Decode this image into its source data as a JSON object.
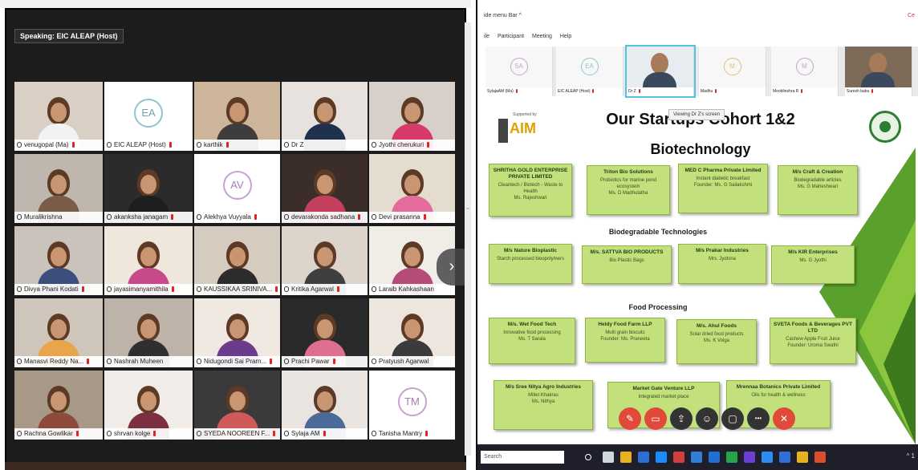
{
  "left_panel": {
    "top_strip_text": "",
    "speaking_label": "Speaking: EIC ALEAP (Host)",
    "next_page_glyph": "›",
    "scroll_glyph": "⌃",
    "participants": [
      {
        "name": "venugopal (Ma)",
        "mic": "muted",
        "kind": "video"
      },
      {
        "name": "EIC ALEAP (Host)",
        "mic": "muted",
        "kind": "initials",
        "initials": "EA",
        "active": true
      },
      {
        "name": "karthik",
        "mic": "muted",
        "kind": "video"
      },
      {
        "name": "Dr Z",
        "mic": "on",
        "kind": "video"
      },
      {
        "name": "Jyothi cherukuri",
        "mic": "muted",
        "kind": "video"
      },
      {
        "name": "Muralikrishna",
        "mic": "on",
        "kind": "video"
      },
      {
        "name": "akanksha janagam",
        "mic": "muted",
        "kind": "video"
      },
      {
        "name": "Alekhya Vuyyala",
        "mic": "muted",
        "kind": "initials",
        "initials": "AV"
      },
      {
        "name": "devarakonda sadhana",
        "mic": "muted",
        "kind": "video"
      },
      {
        "name": "Devi prasanna",
        "mic": "muted",
        "kind": "video"
      },
      {
        "name": "Divya Phani Kodati",
        "mic": "muted",
        "kind": "video"
      },
      {
        "name": "jayasimanyamithila",
        "mic": "muted",
        "kind": "video"
      },
      {
        "name": "KAUSSIKAA SRINIVA...",
        "mic": "muted",
        "kind": "video"
      },
      {
        "name": "Kritika Agarwal",
        "mic": "muted",
        "kind": "video"
      },
      {
        "name": "Laraib Kahkashaan",
        "mic": "on",
        "kind": "video"
      },
      {
        "name": "Manasvi Reddy Na...",
        "mic": "muted",
        "kind": "video"
      },
      {
        "name": "Nashrah Muheen",
        "mic": "on",
        "kind": "video"
      },
      {
        "name": "Nidugondi Sai Prarn...",
        "mic": "muted",
        "kind": "video"
      },
      {
        "name": "Prachi Pawar",
        "mic": "muted",
        "kind": "video"
      },
      {
        "name": "Pratyush Agarwal",
        "mic": "on",
        "kind": "video"
      },
      {
        "name": "Rachna Gowlikar",
        "mic": "muted",
        "kind": "video"
      },
      {
        "name": "shrvan kolge",
        "mic": "muted",
        "kind": "video"
      },
      {
        "name": "SYEDA NOOREEN F...",
        "mic": "muted",
        "kind": "video"
      },
      {
        "name": "Sylaja AM",
        "mic": "muted",
        "kind": "video"
      },
      {
        "name": "Tanisha Mantry",
        "mic": "muted",
        "kind": "initials",
        "initials": "TM"
      }
    ]
  },
  "right_panel": {
    "window_title": "ide menu Bar ^",
    "corner_text": "Ce",
    "menu": [
      "ile",
      "Participant",
      "Meeting",
      "Help"
    ],
    "strip": [
      {
        "name": "SylajaAM (Ma)",
        "initials": "SA",
        "color": "#c8a2cf"
      },
      {
        "name": "EIC ALEAP (Host)",
        "initials": "EA",
        "color": "#8ec6ce"
      },
      {
        "name": "Dr Z",
        "initials": "",
        "color": "#8ec6ce",
        "video": true
      },
      {
        "name": "Madhu",
        "initials": "M",
        "color": "#e0c070"
      },
      {
        "name": "Mooblinshra R",
        "initials": "M",
        "color": "#c8a2cf"
      },
      {
        "name": "Suresh babu",
        "initials": "",
        "color": "#8ec6ce",
        "video": true
      }
    ],
    "slide": {
      "title": "Our Startups Cohort 1&2",
      "subtitle": "Biotechnology",
      "share_note": "Viewing Dr Z's screen",
      "logo_text": "AIM",
      "logo_sup": "Supported by",
      "sections": [
        "Biodegradable Technologies",
        "Food Processing"
      ],
      "cards": [
        {
          "name": "SHRITHA GOLD ENTERPRISE PRIVATE LIMITED",
          "desc": "Cleantech / Biotech - Waste to Health",
          "founder": "Ms. Rajeshwari"
        },
        {
          "name": "Triton Bio Solutions",
          "desc": "Probiotics for marine pond ecosystem",
          "founder": "Ms. D Madhulatha"
        },
        {
          "name": "MED C Pharma Private Limited",
          "desc": "Instant diabetic breakfast",
          "founder": "Founder: Ms. G Sailakshmi"
        },
        {
          "name": "M/s Craft & Creation",
          "desc": "Biodegradable articles",
          "founder": "Ms. G Maheshwari"
        },
        {
          "name": "M/s Nature Bioplastic",
          "desc": "Starch processed bioopolymers",
          "founder": ""
        },
        {
          "name": "M/s. SATTVA BIO PRODUCTS",
          "desc": "Bio Plastic Bags",
          "founder": ""
        },
        {
          "name": "M/s Prakar Industries",
          "desc": "Mrs. Jyotsna",
          "founder": ""
        },
        {
          "name": "M/s KIR Enterprises",
          "desc": "Ms. G Jyothi",
          "founder": ""
        },
        {
          "name": "M/s. Wet Food Tech",
          "desc": "Innovative food processing",
          "founder": "Ms. T Sarala"
        },
        {
          "name": "Heldy Food Farm LLP",
          "desc": "Multi grain biscuits",
          "founder": "Founder: Ms. Praneeta"
        },
        {
          "name": "M/s. Ahul Foods",
          "desc": "Solar dried food products",
          "founder": "Ms. K Volga"
        },
        {
          "name": "SVETA Foods & Beverages PVT LTD",
          "desc": "Cashew Apple Fruit Juice",
          "founder": "Founder: Uroma Swathi"
        },
        {
          "name": "M/s Sree Nitya Agro Industries",
          "desc": "Millet Khakras",
          "founder": "Ms. Nithya"
        },
        {
          "name": "Market Gate Venture LLP",
          "desc": "Integrated market place",
          "founder": ""
        },
        {
          "name": "Mrennaa Botanics Private Limited",
          "desc": "Oils for health & wellness",
          "founder": ""
        }
      ]
    },
    "controls": [
      "mic-off",
      "video-off",
      "share",
      "participants",
      "chat",
      "more",
      "end"
    ],
    "taskbar_search": "Search",
    "taskbar_tray": "^ 1"
  }
}
